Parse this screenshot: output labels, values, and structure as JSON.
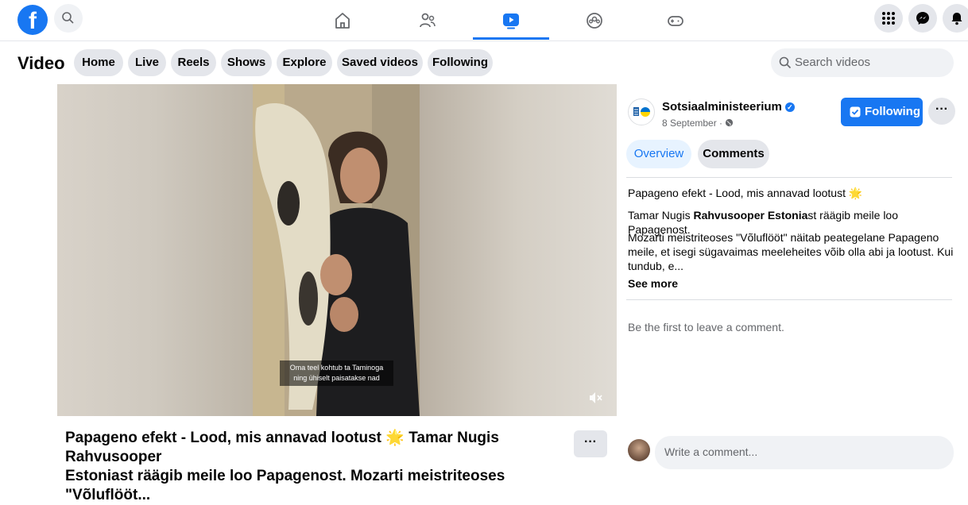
{
  "nav": {
    "logo": "f"
  },
  "subnav": {
    "title": "Video",
    "tabs": [
      "Home",
      "Live",
      "Reels",
      "Shows",
      "Explore",
      "Saved videos",
      "Following"
    ],
    "search_placeholder": "Search videos"
  },
  "player": {
    "caption_line1": "Oma teel kohtub ta Taminoga",
    "caption_line2": "ning ühiselt paisatakse nad"
  },
  "video": {
    "title_line1": "Papageno efekt - Lood, mis annavad lootust 🌟 Tamar Nugis Rahvusooper",
    "title_line2": "Estoniast räägib meile loo Papagenost. Mozarti meistriteoses \"Võluflööt..."
  },
  "sidebar": {
    "page_name": "Sotsiaalministeerium",
    "date": "8 September · ",
    "following_label": "Following",
    "tabs": [
      "Overview",
      "Comments"
    ],
    "desc_line1": "Papageno efekt - Lood, mis annavad lootust 🌟",
    "desc_line2_pre": "Tamar Nugis ",
    "desc_line2_bold": "Rahvusooper Estonia",
    "desc_line2_post": "st räägib meile loo Papagenost.",
    "desc_para": "Mozarti meistriteoses \"Võluflööt\" näitab peategelane Papageno meile, et isegi sügavaimas meeleheites võib olla abi ja lootust. Kui tundub, e...",
    "see_more": "See more",
    "no_comments": "Be the first to leave a comment.",
    "comment_placeholder": "Write a comment..."
  },
  "colors": {
    "brand": "#1877f2",
    "pill_bg": "#e4e6eb"
  }
}
